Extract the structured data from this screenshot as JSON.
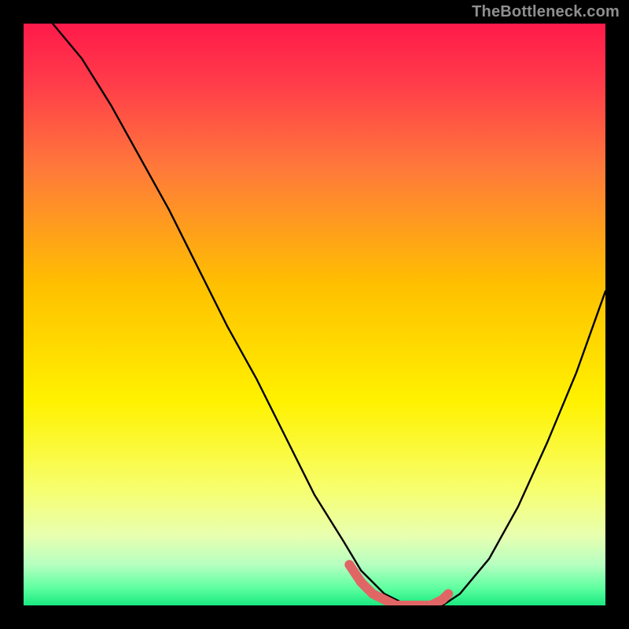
{
  "watermark": {
    "text": "TheBottleneck.com"
  },
  "chart_data": {
    "type": "line",
    "title": "",
    "xlabel": "",
    "ylabel": "",
    "xlim": [
      0,
      100
    ],
    "ylim": [
      0,
      100
    ],
    "grid": false,
    "series": [
      {
        "name": "bottleneck-curve",
        "color": "#000000",
        "x": [
          5,
          10,
          15,
          20,
          25,
          30,
          35,
          40,
          45,
          50,
          55,
          58,
          62,
          66,
          70,
          72,
          75,
          80,
          85,
          90,
          95,
          100
        ],
        "y": [
          100,
          94,
          86,
          77,
          68,
          58,
          48,
          39,
          29,
          19,
          11,
          6,
          2,
          0,
          0,
          0,
          2,
          8,
          17,
          28,
          40,
          54
        ]
      },
      {
        "name": "optimal-marker",
        "color": "#e06666",
        "type": "scatter",
        "x": [
          56,
          58,
          60,
          62,
          64,
          66,
          68,
          70,
          72,
          73
        ],
        "y": [
          7,
          4,
          2,
          1,
          0,
          0,
          0,
          0,
          1,
          2
        ]
      }
    ],
    "background_gradient": {
      "stops": [
        {
          "offset": 0.0,
          "color": "#ff1a4a"
        },
        {
          "offset": 0.1,
          "color": "#ff3b4a"
        },
        {
          "offset": 0.25,
          "color": "#ff7a3a"
        },
        {
          "offset": 0.45,
          "color": "#ffc000"
        },
        {
          "offset": 0.65,
          "color": "#fff200"
        },
        {
          "offset": 0.8,
          "color": "#f7ff6e"
        },
        {
          "offset": 0.88,
          "color": "#e8ffb0"
        },
        {
          "offset": 0.93,
          "color": "#b6ffc0"
        },
        {
          "offset": 0.97,
          "color": "#5fffa0"
        },
        {
          "offset": 1.0,
          "color": "#19e880"
        }
      ]
    }
  }
}
